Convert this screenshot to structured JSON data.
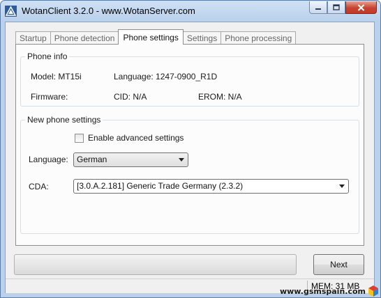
{
  "window": {
    "title": "WotanClient 3.2.0 - www.WotanServer.com"
  },
  "tabs": [
    {
      "label": "Startup",
      "active": false
    },
    {
      "label": "Phone detection",
      "active": false
    },
    {
      "label": "Phone settings",
      "active": true
    },
    {
      "label": "Settings",
      "active": false
    },
    {
      "label": "Phone processing",
      "active": false
    }
  ],
  "phone_info": {
    "title": "Phone info",
    "model": "Model: MT15i",
    "language": "Language: 1247-0900_R1D",
    "firmware": "Firmware:",
    "cid": "CID: N/A",
    "erom": "EROM: N/A"
  },
  "new_settings": {
    "title": "New phone settings",
    "advanced_label": "Enable advanced settings",
    "advanced_checked": false,
    "language_label": "Language:",
    "language_value": "German",
    "cda_label": "CDA:",
    "cda_value": "[3.0.A.2.181] Generic Trade Germany (2.3.2)"
  },
  "footer": {
    "progress_fraction": 0,
    "next_label": "Next",
    "mem": "MEM: 31 MB"
  },
  "watermark": "www.gsmspain.com",
  "colors": {
    "titlebar": "#b9d1ec",
    "close_button": "#c8432f",
    "panel_background": "#f0f0f0"
  }
}
